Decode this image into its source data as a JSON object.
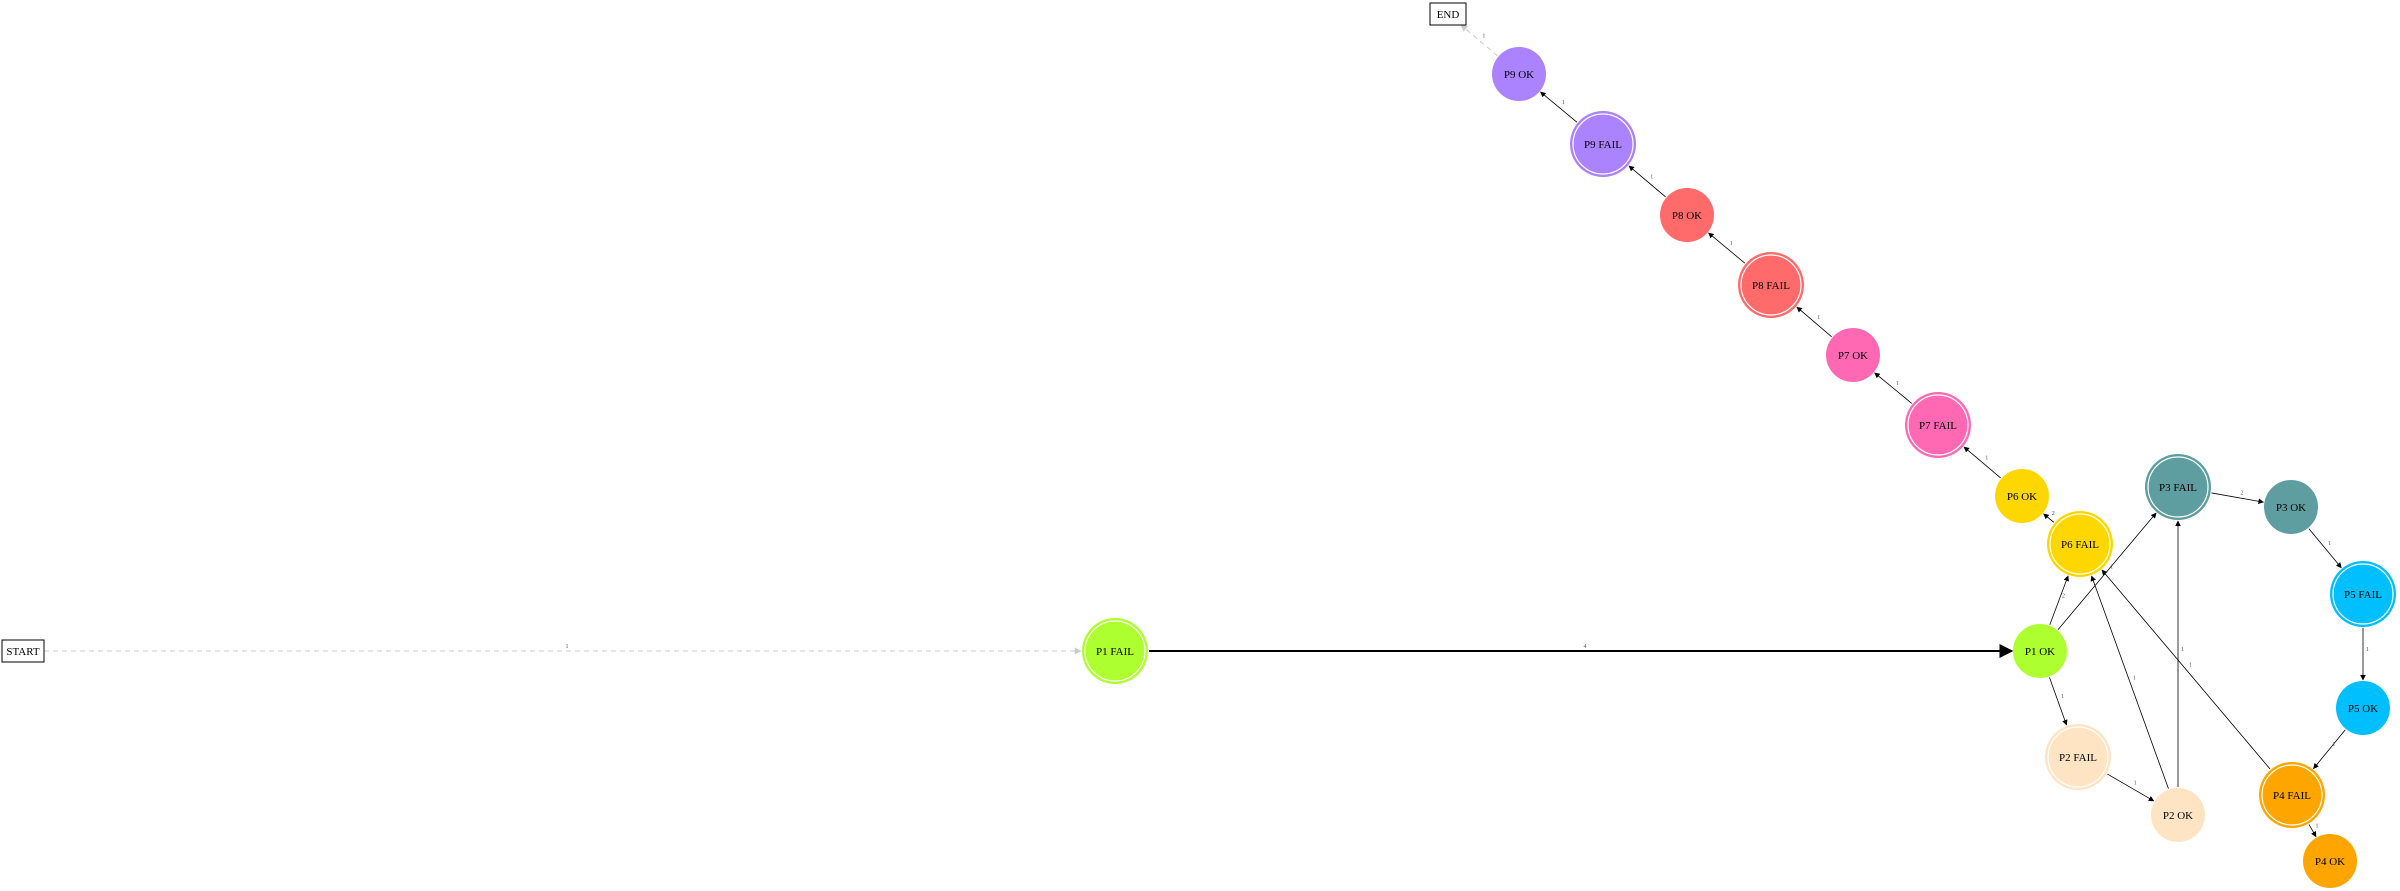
{
  "diagram": {
    "terminals": [
      {
        "id": "start",
        "label": "START"
      },
      {
        "id": "end",
        "label": "END"
      }
    ],
    "nodes": [
      {
        "id": "p1fail",
        "label": "P1 FAIL",
        "color": "#adff2f",
        "fail": true
      },
      {
        "id": "p1ok",
        "label": "P1 OK",
        "color": "#adff2f",
        "fail": false
      },
      {
        "id": "p2fail",
        "label": "P2 FAIL",
        "color": "#ffe4c4",
        "fail": true
      },
      {
        "id": "p2ok",
        "label": "P2 OK",
        "color": "#ffe4c4",
        "fail": false
      },
      {
        "id": "p3fail",
        "label": "P3 FAIL",
        "color": "#5f9ea0",
        "fail": true
      },
      {
        "id": "p3ok",
        "label": "P3 OK",
        "color": "#5f9ea0",
        "fail": false
      },
      {
        "id": "p4fail",
        "label": "P4 FAIL",
        "color": "#ffa500",
        "fail": true
      },
      {
        "id": "p4ok",
        "label": "P4 OK",
        "color": "#ffa500",
        "fail": false
      },
      {
        "id": "p5fail",
        "label": "P5 FAIL",
        "color": "#00bfff",
        "fail": true
      },
      {
        "id": "p5ok",
        "label": "P5 OK",
        "color": "#00bfff",
        "fail": false
      },
      {
        "id": "p6fail",
        "label": "P6 FAIL",
        "color": "#ffd700",
        "fail": true
      },
      {
        "id": "p6ok",
        "label": "P6 OK",
        "color": "#ffd700",
        "fail": false
      },
      {
        "id": "p7fail",
        "label": "P7 FAIL",
        "color": "#ff69b4",
        "fail": true
      },
      {
        "id": "p7ok",
        "label": "P7 OK",
        "color": "#ff69b4",
        "fail": false
      },
      {
        "id": "p8fail",
        "label": "P8 FAIL",
        "color": "#ff6a6a",
        "fail": true
      },
      {
        "id": "p8ok",
        "label": "P8 OK",
        "color": "#ff6a6a",
        "fail": false
      },
      {
        "id": "p9fail",
        "label": "P9 FAIL",
        "color": "#ab82ff",
        "fail": true
      },
      {
        "id": "p9ok",
        "label": "P9 OK",
        "color": "#ab82ff",
        "fail": false
      }
    ],
    "edges": [
      {
        "from": "start",
        "to": "p1fail",
        "label": "1",
        "style": "dashed"
      },
      {
        "from": "p1fail",
        "to": "p1ok",
        "label": "4",
        "style": "bold"
      },
      {
        "from": "p1ok",
        "to": "p2fail",
        "label": "1",
        "style": "solid"
      },
      {
        "from": "p1ok",
        "to": "p3fail",
        "label": "1",
        "style": "solid"
      },
      {
        "from": "p1ok",
        "to": "p6fail",
        "label": "2",
        "style": "solid"
      },
      {
        "from": "p2fail",
        "to": "p2ok",
        "label": "1",
        "style": "solid"
      },
      {
        "from": "p2ok",
        "to": "p3fail",
        "label": "1",
        "style": "solid"
      },
      {
        "from": "p2ok",
        "to": "p6fail",
        "label": "1",
        "style": "solid"
      },
      {
        "from": "p3fail",
        "to": "p3ok",
        "label": "2",
        "style": "solid"
      },
      {
        "from": "p3ok",
        "to": "p5fail",
        "label": "1",
        "style": "solid"
      },
      {
        "from": "p5fail",
        "to": "p5ok",
        "label": "1",
        "style": "solid"
      },
      {
        "from": "p5ok",
        "to": "p4fail",
        "label": "1",
        "style": "solid"
      },
      {
        "from": "p4fail",
        "to": "p4ok",
        "label": "1",
        "style": "solid"
      },
      {
        "from": "p4fail",
        "to": "p6fail",
        "label": "1",
        "style": "solid"
      },
      {
        "from": "p6fail",
        "to": "p6ok",
        "label": "2",
        "style": "solid"
      },
      {
        "from": "p6ok",
        "to": "p7fail",
        "label": "1",
        "style": "solid"
      },
      {
        "from": "p7fail",
        "to": "p7ok",
        "label": "1",
        "style": "solid"
      },
      {
        "from": "p7ok",
        "to": "p8fail",
        "label": "1",
        "style": "solid"
      },
      {
        "from": "p8fail",
        "to": "p8ok",
        "label": "1",
        "style": "solid"
      },
      {
        "from": "p8ok",
        "to": "p9fail",
        "label": "1",
        "style": "solid"
      },
      {
        "from": "p9fail",
        "to": "p9ok",
        "label": "1",
        "style": "solid"
      },
      {
        "from": "p9ok",
        "to": "end",
        "label": "1",
        "style": "dashed"
      }
    ]
  }
}
